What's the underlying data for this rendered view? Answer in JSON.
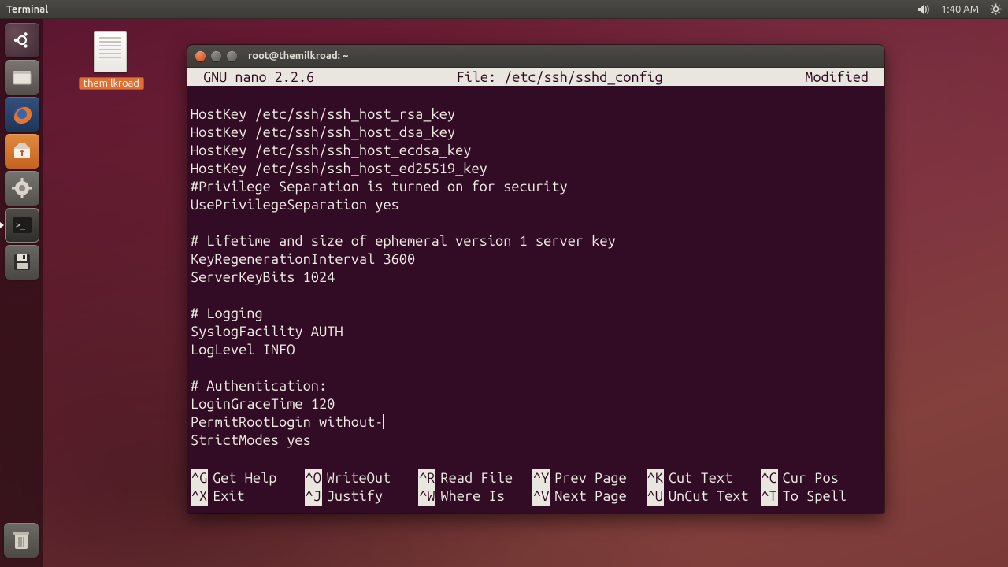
{
  "panel": {
    "app_label": "Terminal",
    "clock": "1:40 AM"
  },
  "desktop_icon": {
    "label": "themilkroad"
  },
  "launcher": {
    "items": [
      {
        "name": "dash-home",
        "running": false
      },
      {
        "name": "files",
        "running": false
      },
      {
        "name": "firefox",
        "running": false
      },
      {
        "name": "ubuntu-software",
        "running": false
      },
      {
        "name": "system-settings",
        "running": false
      },
      {
        "name": "terminal",
        "running": true
      },
      {
        "name": "save-session",
        "running": false
      }
    ],
    "trash": {
      "name": "trash"
    }
  },
  "terminal": {
    "title": "root@themilkroad: ~",
    "nano": {
      "version": "GNU nano 2.2.6",
      "file_label": "File: /etc/ssh/sshd_config",
      "status": "Modified",
      "lines": [
        "",
        "HostKey /etc/ssh/ssh_host_rsa_key",
        "HostKey /etc/ssh/ssh_host_dsa_key",
        "HostKey /etc/ssh/ssh_host_ecdsa_key",
        "HostKey /etc/ssh/ssh_host_ed25519_key",
        "#Privilege Separation is turned on for security",
        "UsePrivilegeSeparation yes",
        "",
        "# Lifetime and size of ephemeral version 1 server key",
        "KeyRegenerationInterval 3600",
        "ServerKeyBits 1024",
        "",
        "# Logging",
        "SyslogFacility AUTH",
        "LogLevel INFO",
        "",
        "# Authentication:",
        "LoginGraceTime 120",
        "PermitRootLogin without-",
        "StrictModes yes"
      ],
      "cursor_line_index": 18,
      "shortcuts_row1": [
        {
          "key": "^G",
          "label": "Get Help"
        },
        {
          "key": "^O",
          "label": "WriteOut"
        },
        {
          "key": "^R",
          "label": "Read File"
        },
        {
          "key": "^Y",
          "label": "Prev Page"
        },
        {
          "key": "^K",
          "label": "Cut Text"
        },
        {
          "key": "^C",
          "label": "Cur Pos"
        }
      ],
      "shortcuts_row2": [
        {
          "key": "^X",
          "label": "Exit"
        },
        {
          "key": "^J",
          "label": "Justify"
        },
        {
          "key": "^W",
          "label": "Where Is"
        },
        {
          "key": "^V",
          "label": "Next Page"
        },
        {
          "key": "^U",
          "label": "UnCut Text"
        },
        {
          "key": "^T",
          "label": "To Spell"
        }
      ]
    }
  }
}
